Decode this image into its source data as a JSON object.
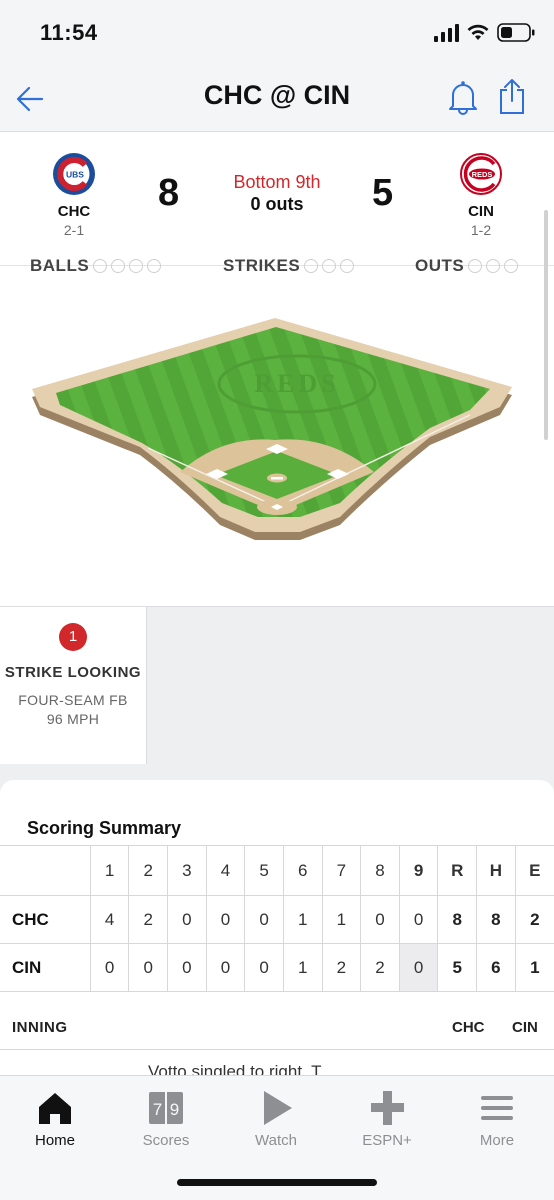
{
  "status_bar": {
    "time": "11:54"
  },
  "nav": {
    "title": "CHC @ CIN"
  },
  "game": {
    "away": {
      "abbr": "CHC",
      "record": "2-1",
      "runs": "8",
      "logo_text": "UBS"
    },
    "home": {
      "abbr": "CIN",
      "record": "1-2",
      "runs": "5",
      "logo_text": "REDS"
    },
    "inning": "Bottom 9th",
    "outs": "0 outs"
  },
  "count": {
    "balls_label": "BALLS",
    "strikes_label": "STRIKES",
    "outs_label": "OUTS"
  },
  "field": {
    "logo_text": "REDS"
  },
  "pitch": {
    "number": "1",
    "result": "STRIKE LOOKING",
    "type": "FOUR-SEAM FB",
    "speed": "96 MPH"
  },
  "summary": {
    "title": "Scoring Summary",
    "headers": [
      "1",
      "2",
      "3",
      "4",
      "5",
      "6",
      "7",
      "8",
      "9",
      "R",
      "H",
      "E"
    ],
    "rows": [
      {
        "team": "CHC",
        "cells": [
          "4",
          "2",
          "0",
          "0",
          "0",
          "1",
          "1",
          "0",
          "0",
          "8",
          "8",
          "2"
        ]
      },
      {
        "team": "CIN",
        "cells": [
          "0",
          "0",
          "0",
          "0",
          "0",
          "1",
          "2",
          "2",
          "0",
          "5",
          "6",
          "1"
        ]
      }
    ],
    "inning_label": "INNING",
    "col_chc": "CHC",
    "col_cin": "CIN",
    "play_text": "Votto singled to right. T."
  },
  "tabs": [
    {
      "label": "Home",
      "icon": "home-icon",
      "active": true
    },
    {
      "label": "Scores",
      "icon": "scoreboard-icon",
      "active": false,
      "badge": "7|9"
    },
    {
      "label": "Watch",
      "icon": "play-icon",
      "active": false
    },
    {
      "label": "ESPN+",
      "icon": "plus-icon",
      "active": false
    },
    {
      "label": "More",
      "icon": "menu-icon",
      "active": false
    }
  ],
  "colors": {
    "accent_red": "#d0282b",
    "link_blue": "#2f6fd6",
    "grass": "#5aaf3c",
    "dirt": "#dcc39a"
  }
}
